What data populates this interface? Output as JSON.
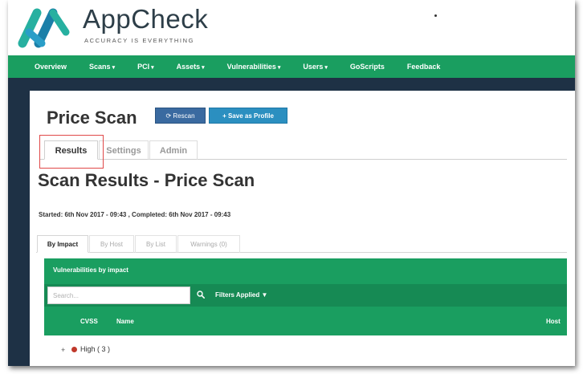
{
  "brand": {
    "name": "AppCheck",
    "tagline": "ACCURACY IS EVERYTHING",
    "colors": {
      "green": "#1a9e60",
      "dark_navy": "#1e3145",
      "logo_teal": "#27b0a0"
    }
  },
  "nav": {
    "items": [
      {
        "label": "Overview",
        "caret": ""
      },
      {
        "label": "Scans",
        "caret": "▾"
      },
      {
        "label": "PCI",
        "caret": "▾"
      },
      {
        "label": "Assets",
        "caret": "▾"
      },
      {
        "label": "Vulnerabilities",
        "caret": "▾"
      },
      {
        "label": "Users",
        "caret": "▾"
      },
      {
        "label": "GoScripts",
        "caret": ""
      },
      {
        "label": "Feedback",
        "caret": ""
      }
    ]
  },
  "page": {
    "title": "Price Scan",
    "rescan_label": "⟳ Rescan",
    "save_profile_label": "+ Save as Profile",
    "tabs": [
      "Results",
      "Settings",
      "Admin"
    ],
    "active_tab": "Results"
  },
  "results": {
    "title": "Scan Results - Price Scan",
    "meta": "Started: 6th Nov 2017 - 09:43 , Completed: 6th Nov 2017 - 09:43",
    "subtabs": [
      "By Impact",
      "By Host",
      "By List",
      "Warnings (0)"
    ]
  },
  "vulns": {
    "header": "Vulnerabilities by impact",
    "search_placeholder": "Search...",
    "filters_label": "Filters Applied ▼",
    "columns": {
      "cvss": "CVSS",
      "name": "Name",
      "host": "Host"
    },
    "rows": [
      {
        "toggle": "+",
        "severity_color": "#c0392b",
        "label": "High ( 3 )"
      }
    ]
  }
}
